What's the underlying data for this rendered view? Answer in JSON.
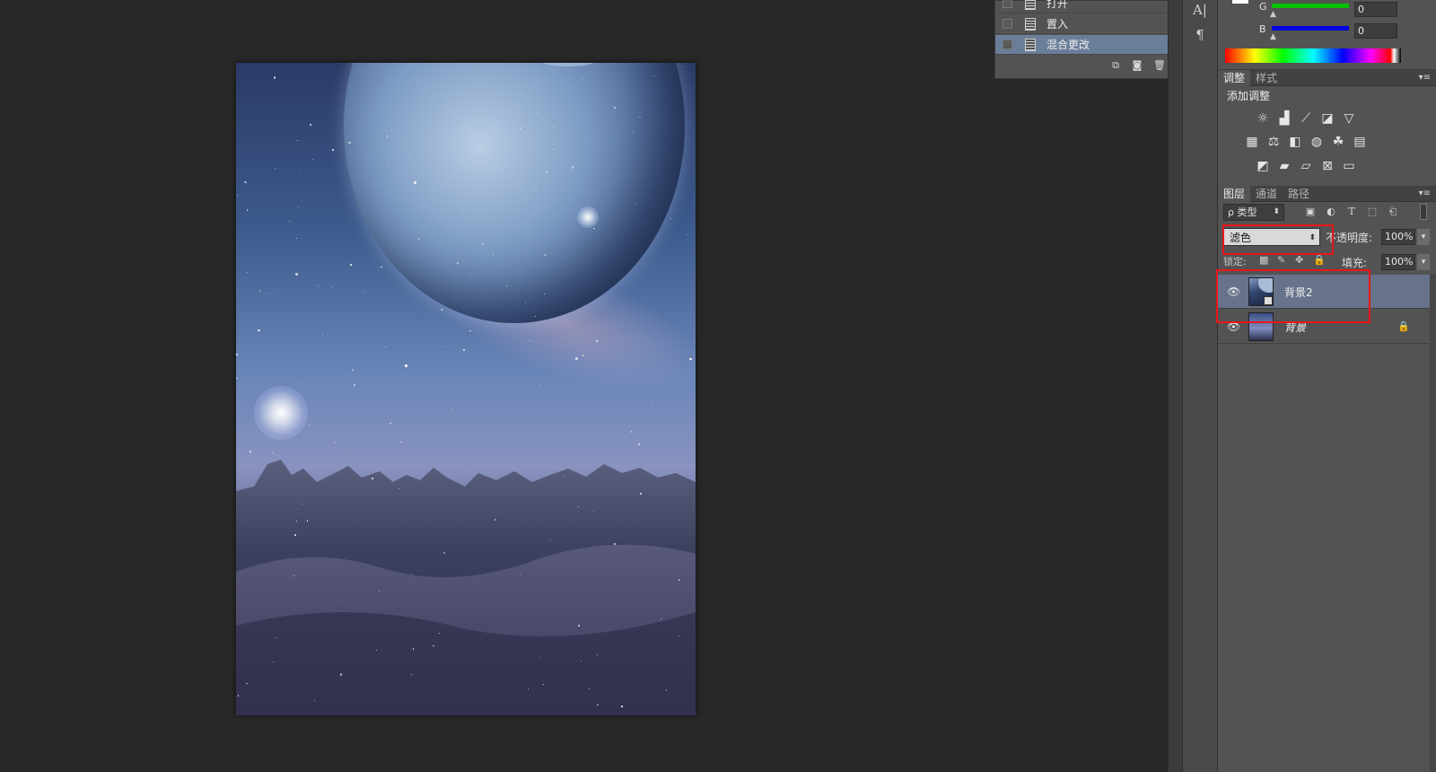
{
  "history": {
    "items": [
      {
        "label": "打开",
        "selected": false
      },
      {
        "label": "置入",
        "selected": false
      },
      {
        "label": "混合更改",
        "selected": true
      }
    ],
    "footer_icons": [
      "new-document-from-state-icon",
      "camera-icon",
      "trash-icon"
    ]
  },
  "dock": {
    "icons": [
      {
        "name": "character-icon",
        "glyph": "A|"
      },
      {
        "name": "paragraph-icon",
        "glyph": "¶"
      }
    ]
  },
  "color": {
    "g_label": "G",
    "g_value": "0",
    "b_label": "B",
    "b_value": "0",
    "g_color": "#00c000",
    "b_color": "#0000e0"
  },
  "adjustments": {
    "tabs": [
      "调整",
      "样式"
    ],
    "title": "添加调整",
    "menu_glyph": "▾≡"
  },
  "layers_panel": {
    "tabs": [
      "图层",
      "通道",
      "路径"
    ],
    "menu_glyph": "▾≡",
    "filter_label": "ρ 类型",
    "filter_arrow": "⬍",
    "blend_mode": "滤色",
    "blend_arrow": "⬍",
    "opacity_label": "不透明度:",
    "opacity_value": "100%",
    "lock_label": "锁定:",
    "fill_label": "填充:",
    "fill_value": "100%",
    "dropdown_glyph": "▾",
    "layers": [
      {
        "name": "背景2",
        "selected": true,
        "locked": false
      },
      {
        "name": "背景",
        "selected": false,
        "locked": true
      }
    ]
  },
  "highlight_color": "#e8161b"
}
